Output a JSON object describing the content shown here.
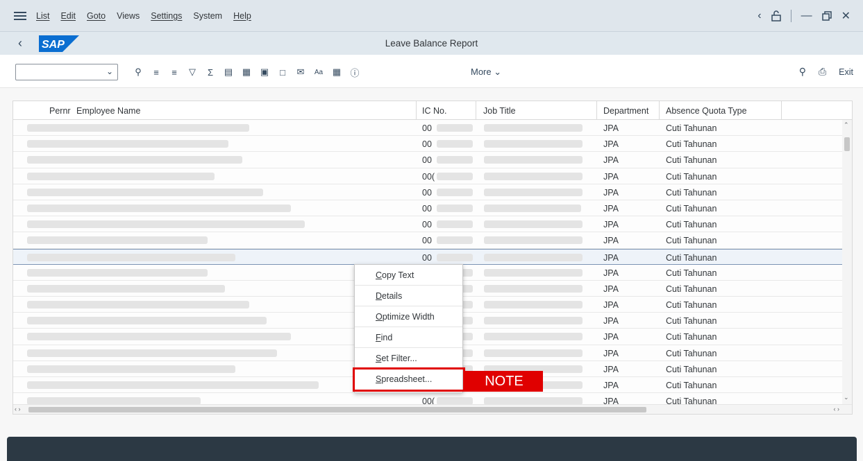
{
  "menu": {
    "items": [
      "List",
      "Edit",
      "Goto",
      "Views",
      "Settings",
      "System",
      "Help"
    ]
  },
  "window": {
    "title": "Leave Balance Report"
  },
  "toolbar": {
    "more_label": "More",
    "exit_label": "Exit",
    "icons": [
      "zoom-icon",
      "sort-ascending-icon",
      "sort-descending-icon",
      "filter-icon",
      "sum-icon",
      "print-preview-icon",
      "export-icon",
      "word-icon",
      "local-file-icon",
      "mail-icon",
      "abc-icon",
      "layout-icon",
      "info-icon"
    ]
  },
  "table": {
    "headers": {
      "pernr": "Pernr",
      "employee_name": "Employee Name",
      "ic_no": "IC No.",
      "job_title": "Job Title",
      "department": "Department",
      "absence_quota_type": "Absence Quota Type"
    },
    "rows": [
      {
        "ic_prefix": "00",
        "department": "JPA",
        "quota_type": "Cuti Tahunan"
      },
      {
        "ic_prefix": "00",
        "department": "JPA",
        "quota_type": "Cuti Tahunan"
      },
      {
        "ic_prefix": "00",
        "department": "JPA",
        "quota_type": "Cuti Tahunan"
      },
      {
        "ic_prefix": "00(",
        "department": "JPA",
        "quota_type": "Cuti Tahunan"
      },
      {
        "ic_prefix": "00",
        "department": "JPA",
        "quota_type": "Cuti Tahunan"
      },
      {
        "ic_prefix": "00",
        "department": "JPA",
        "quota_type": "Cuti Tahunan"
      },
      {
        "ic_prefix": "00",
        "department": "JPA",
        "quota_type": "Cuti Tahunan"
      },
      {
        "ic_prefix": "00",
        "department": "JPA",
        "quota_type": "Cuti Tahunan"
      },
      {
        "ic_prefix": "00",
        "department": "JPA",
        "quota_type": "Cuti Tahunan"
      },
      {
        "ic_prefix": "",
        "department": "JPA",
        "quota_type": "Cuti Tahunan"
      },
      {
        "ic_prefix": "",
        "department": "JPA",
        "quota_type": "Cuti Tahunan"
      },
      {
        "ic_prefix": "",
        "department": "JPA",
        "quota_type": "Cuti Tahunan"
      },
      {
        "ic_prefix": "",
        "department": "JPA",
        "quota_type": "Cuti Tahunan"
      },
      {
        "ic_prefix": "",
        "department": "JPA",
        "quota_type": "Cuti Tahunan"
      },
      {
        "ic_prefix": "",
        "department": "JPA",
        "quota_type": "Cuti Tahunan"
      },
      {
        "ic_prefix": "",
        "department": "JPA",
        "quota_type": "Cuti Tahunan"
      },
      {
        "ic_prefix": "",
        "department": "JPA",
        "quota_type": "Cuti Tahunan"
      },
      {
        "ic_prefix": "00(",
        "department": "JPA",
        "quota_type": "Cuti Tahunan"
      }
    ]
  },
  "context_menu": {
    "items": [
      {
        "label": "Copy Text",
        "accel": "C",
        "rest": "opy Text"
      },
      {
        "label": "Details",
        "accel": "D",
        "rest": "etails"
      },
      {
        "label": "Optimize Width",
        "accel": "O",
        "rest": "ptimize Width"
      },
      {
        "label": "Find",
        "accel": "F",
        "rest": "ind"
      },
      {
        "label": "Set Filter...",
        "accel": "S",
        "rest": "et Filter..."
      },
      {
        "label": "Spreadsheet...",
        "accel": "S",
        "rest": "preadsheet..."
      }
    ]
  },
  "annotation": {
    "note_label": "NOTE",
    "color": "#e00000"
  },
  "colors": {
    "brand": "#0a6ed1",
    "menubar": "#dfe6ec",
    "status": "#2c3944"
  }
}
